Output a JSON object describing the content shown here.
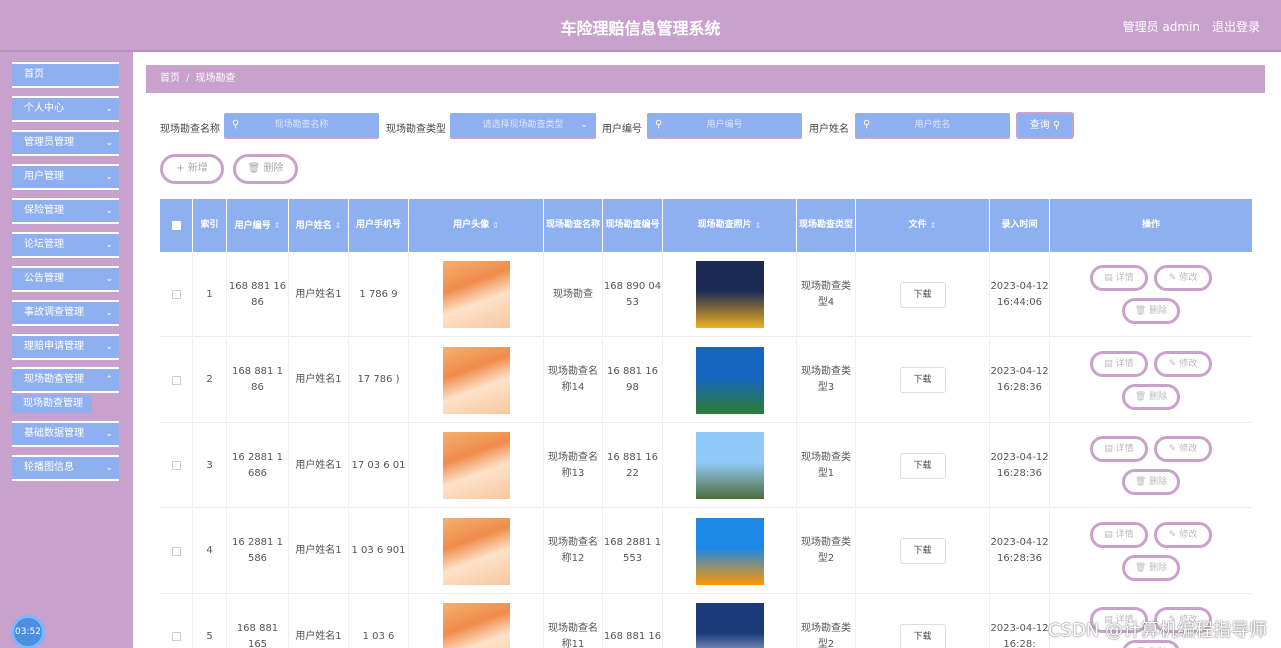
{
  "header": {
    "title": "车险理赔信息管理系统",
    "admin": "管理员 admin",
    "logout": "退出登录"
  },
  "sidebar": {
    "items": [
      {
        "label": "首页",
        "chevron": false
      },
      {
        "label": "个人中心",
        "chevron": true
      },
      {
        "label": "管理员管理",
        "chevron": true
      },
      {
        "label": "用户管理",
        "chevron": true
      },
      {
        "label": "保险管理",
        "chevron": true
      },
      {
        "label": "论坛管理",
        "chevron": true
      },
      {
        "label": "公告管理",
        "chevron": true
      },
      {
        "label": "事故调查管理",
        "chevron": true
      },
      {
        "label": "理赔申请管理",
        "chevron": true
      },
      {
        "label": "现场勘查管理",
        "chevron": true
      },
      {
        "label": "基础数据管理",
        "chevron": true
      },
      {
        "label": "轮播图信息",
        "chevron": true
      }
    ],
    "active_sub": "现场勘查管理",
    "clock": "03:52"
  },
  "breadcrumb": {
    "home": "首页",
    "sep": "/",
    "current": "现场勘查"
  },
  "search": {
    "name_label": "现场勘查名称",
    "name_placeholder": "现场勘查名称",
    "type_label": "现场勘查类型",
    "type_placeholder": "请选择现场勘查类型",
    "user_no_label": "用户编号",
    "user_no_placeholder": "用户编号",
    "user_name_label": "用户姓名",
    "user_name_placeholder": "用户姓名",
    "query": "查询"
  },
  "actions": {
    "add": "新增",
    "delete": "删除"
  },
  "table": {
    "headers": [
      "索引",
      "用户编号",
      "用户姓名",
      "用户手机号",
      "用户头像",
      "现场勘查名称",
      "现场勘查编号",
      "现场勘查照片",
      "现场勘查类型",
      "文件",
      "录入时间",
      "操作"
    ],
    "rows": [
      {
        "index": "1",
        "user_no": "168 881 16 86",
        "user_name": "用户姓名1",
        "phone": "1  786 9",
        "survey_name": "现场勘查",
        "survey_no": "168 890 04 53",
        "photo_colors": [
          "#1b2a55",
          "#f0b020"
        ],
        "type": "现场勘查类型4",
        "file": "下载",
        "time": "2023-04-12 16:44:06"
      },
      {
        "index": "2",
        "user_no": "168 881 1 86",
        "user_name": "用户姓名1",
        "phone": "17  786 )",
        "survey_name": "现场勘查名称14",
        "survey_no": "16 881 16 98",
        "photo_colors": [
          "#1565c0",
          "#2e7d32"
        ],
        "type": "现场勘查类型3",
        "file": "下载",
        "time": "2023-04-12 16:28:36"
      },
      {
        "index": "3",
        "user_no": "16 2881 1 686",
        "user_name": "用户姓名1",
        "phone": "17 03 6 01",
        "survey_name": "现场勘查名称13",
        "survey_no": "16 881 16 22",
        "photo_colors": [
          "#90caf9",
          "#4e6b3a"
        ],
        "type": "现场勘查类型1",
        "file": "下载",
        "time": "2023-04-12 16:28:36"
      },
      {
        "index": "4",
        "user_no": "16 2881 1 586",
        "user_name": "用户姓名1",
        "phone": "1 03 6 901",
        "survey_name": "现场勘查名称12",
        "survey_no": "168 2881 1 553",
        "photo_colors": [
          "#1e88e5",
          "#ff9800"
        ],
        "type": "现场勘查类型2",
        "file": "下载",
        "time": "2023-04-12 16:28:36"
      },
      {
        "index": "5",
        "user_no": "168 881 165",
        "user_name": "用户姓名1",
        "phone": "1 03 6",
        "survey_name": "现场勘查名称11",
        "survey_no": "168 881 16",
        "photo_colors": [
          "#1a3a7a",
          "#e0e8ff"
        ],
        "type": "现场勘查类型2",
        "file": "下载",
        "time": "2023-04-12 16:28:"
      }
    ],
    "row_actions": {
      "detail": "详情",
      "edit": "修改",
      "delete": "删除"
    }
  },
  "watermark": "CSDN @计算机编程指导师"
}
